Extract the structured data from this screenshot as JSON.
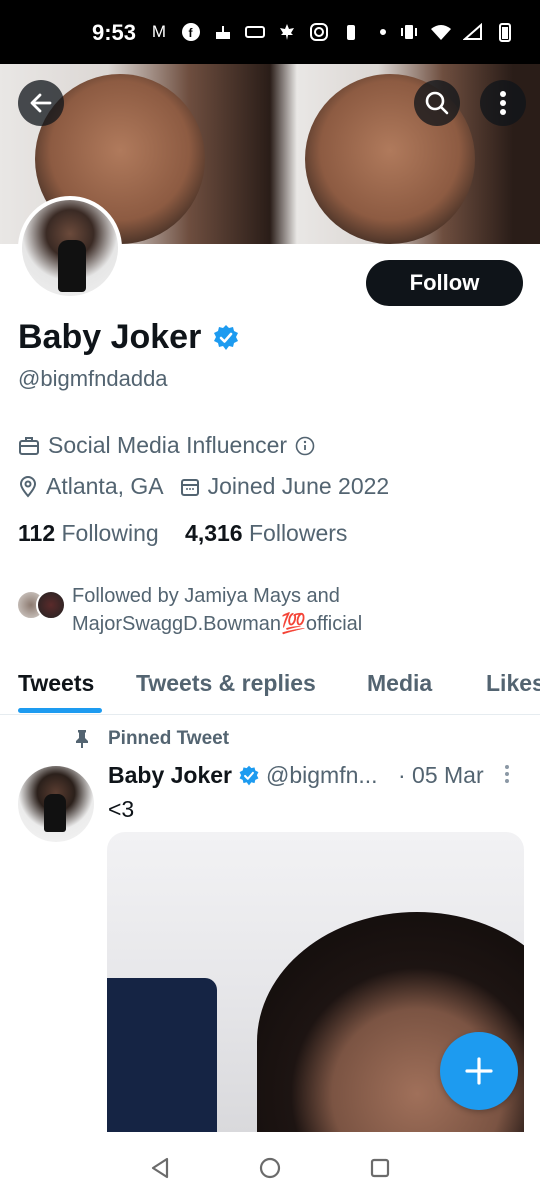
{
  "status_bar": {
    "time": "9:53",
    "left_icons": [
      "gmail-icon",
      "facebook-icon",
      "cake-icon",
      "ticket-icon",
      "maple-leaf-icon",
      "instagram-icon",
      "battery-small-icon",
      "dot-icon"
    ],
    "right_icons": [
      "vibrate-icon",
      "wifi-icon",
      "no-signal-icon",
      "battery-icon"
    ]
  },
  "header": {
    "back_icon": "arrow-left-icon",
    "search_icon": "search-icon",
    "more_icon": "more-vertical-icon"
  },
  "profile": {
    "follow_label": "Follow",
    "name": "Baby Joker",
    "handle": "@bigmfndadda",
    "category": "Social Media Influencer",
    "location": "Atlanta, GA",
    "joined": "Joined June 2022",
    "following_count": "112",
    "following_label": "Following",
    "followers_count": "4,316",
    "followers_label": "Followers",
    "followed_by": "Followed by Jamiya Mays and MajorSwaggD.Bowman💯official"
  },
  "tabs": [
    {
      "label": "Tweets"
    },
    {
      "label": "Tweets & replies"
    },
    {
      "label": "Media"
    },
    {
      "label": "Likes"
    }
  ],
  "tweet": {
    "pinned_label": "Pinned Tweet",
    "author_name": "Baby Joker",
    "author_handle": "@bigmfn...",
    "date": "· 05 Mar",
    "text": "<3"
  },
  "colors": {
    "accent": "#1d9bf0",
    "text": "#0f1419",
    "secondary": "#536471",
    "follow_bg": "#0f1419"
  }
}
